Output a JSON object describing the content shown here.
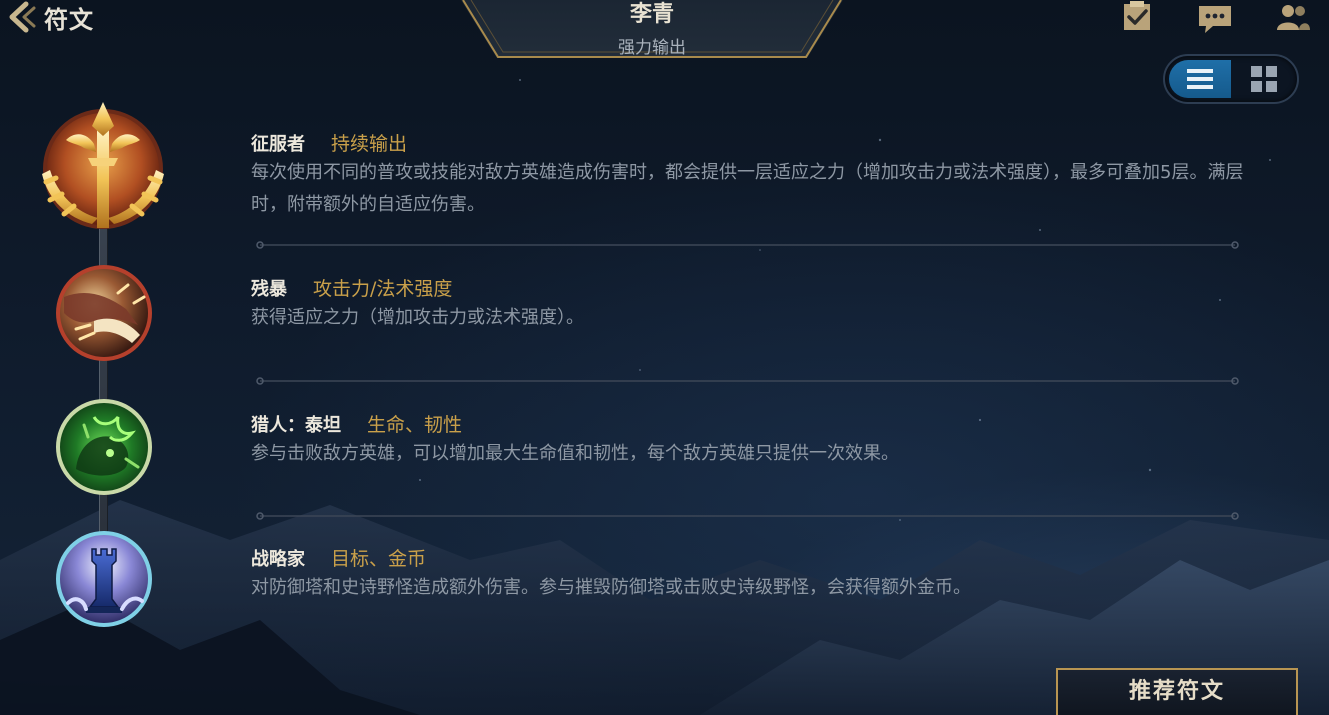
{
  "header": {
    "back_label": "符文",
    "hero_name": "李青",
    "build_name": "强力输出"
  },
  "top_icons": [
    "checklist-icon",
    "chat-icon",
    "friends-icon"
  ],
  "view_toggle": {
    "options": [
      "list-view-icon",
      "grid-view-icon"
    ],
    "selected": "list-view-icon"
  },
  "runes": [
    {
      "name": "征服者",
      "tag": "持续输出",
      "description": "每次使用不同的普攻或技能对敌方英雄造成伤害时，都会提供一层适应之力（增加攻击力或法术强度），最多可叠加5层。满层时，附带额外的自适应伤害。",
      "icon": "conqueror-icon",
      "ring_color": "#b5402c"
    },
    {
      "name": "残暴",
      "tag": "攻击力/法术强度",
      "description": "获得适应之力（增加攻击力或法术强度）。",
      "icon": "brutal-icon",
      "ring_color": "#b5402c"
    },
    {
      "name": "猎人：泰坦",
      "tag": "生命、韧性",
      "description": "参与击败敌方英雄，可以增加最大生命值和韧性，每个敌方英雄只提供一次效果。",
      "icon": "hunter-titan-icon",
      "ring_color": "#8fbf6a"
    },
    {
      "name": "战略家",
      "tag": "目标、金币",
      "description": "对防御塔和史诗野怪造成额外伤害。参与摧毁防御塔或击败史诗级野怪，会获得额外金币。",
      "icon": "strategist-icon",
      "ring_color": "#7fd0e6"
    }
  ],
  "footer": {
    "recommend_label": "推荐符文"
  },
  "colors": {
    "accent_gold": "#c9a04a",
    "toggle_active": "#1f6fa8"
  }
}
